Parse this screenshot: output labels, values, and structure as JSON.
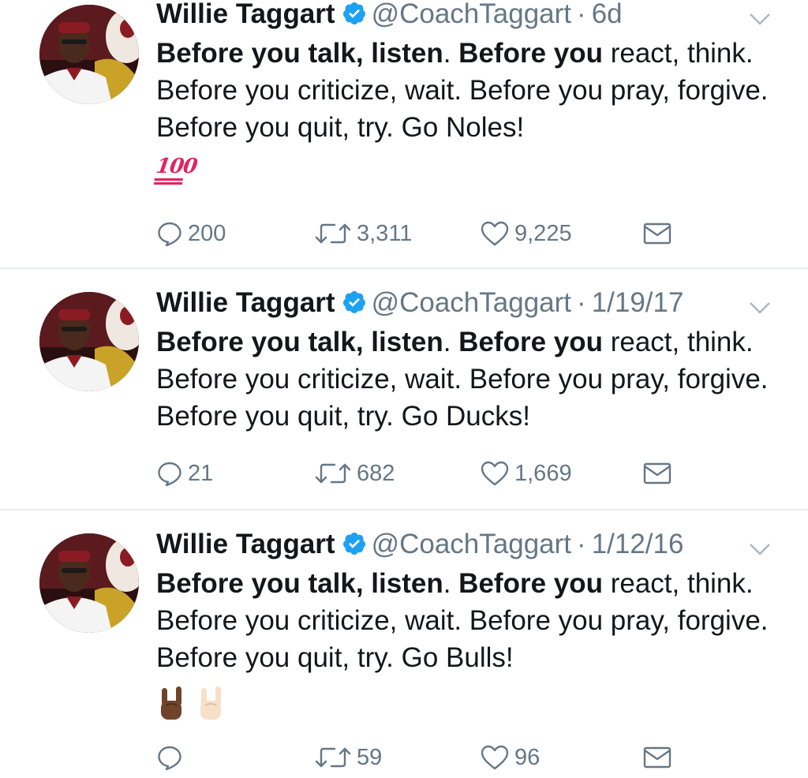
{
  "tweets": [
    {
      "name": "Willie Taggart",
      "handle": "@CoachTaggart",
      "separator": "·",
      "time": "6d",
      "text_bold_1": "Before you talk, listen",
      "text_plain_1": ". ",
      "text_bold_2": "Before you",
      "text_plain_2": " react, think. Before you criticize, wait. Before you pray, forgive. Before you quit, try. Go Noles!",
      "emoji": "100",
      "reply_count": "200",
      "retweet_count": "3,311",
      "like_count": "9,225"
    },
    {
      "name": "Willie Taggart",
      "handle": "@CoachTaggart",
      "separator": "·",
      "time": "1/19/17",
      "text_bold_1": "Before you talk, listen",
      "text_plain_1": ". ",
      "text_bold_2": "Before you",
      "text_plain_2": " react, think. Before you criticize, wait. Before you pray, forgive. Before you quit, try. Go Ducks!",
      "reply_count": "21",
      "retweet_count": "682",
      "like_count": "1,669"
    },
    {
      "name": "Willie Taggart",
      "handle": "@CoachTaggart",
      "separator": "·",
      "time": "1/12/16",
      "text_bold_1": "Before you talk, listen",
      "text_plain_1": ". ",
      "text_bold_2": "Before you",
      "text_plain_2": " react, think. Before you criticize, wait. Before you pray, forgive. Before you quit, try. Go Bulls!",
      "emojis": [
        "horns-hand-dark",
        "horns-hand-light"
      ],
      "reply_count": "",
      "retweet_count": "59",
      "like_count": "96"
    }
  ],
  "icons": {
    "reply": "reply-icon",
    "retweet": "retweet-icon",
    "like": "heart-icon",
    "dm": "envelope-icon",
    "verified": "verified-badge-icon",
    "caret": "chevron-down-icon"
  },
  "colors": {
    "text": "#14171a",
    "secondary": "#657786",
    "verified": "#1da1f2",
    "separator": "#e6ecf0",
    "emoji_100": "#e0245e"
  }
}
